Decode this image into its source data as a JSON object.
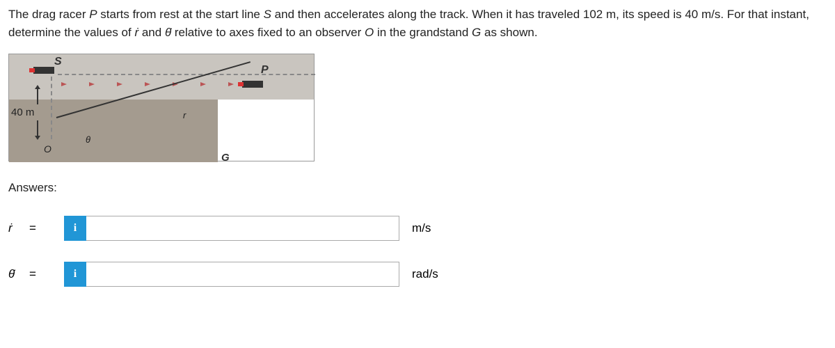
{
  "problem": {
    "text_part1": "The drag racer ",
    "text_part2": " starts from rest at the start line ",
    "text_part3": " and then accelerates along the track. When it has traveled 102 m, its speed is 40 m/s. For that instant, determine the values of ",
    "text_part4": " and ",
    "text_part5": " relative to axes fixed to an observer ",
    "text_part6": " in the grandstand ",
    "text_part7": " as shown.",
    "var_P": "P",
    "var_S": "S",
    "var_rdot": "ṙ",
    "var_thetadot": "θ̇",
    "var_O": "O",
    "var_G": "G"
  },
  "diagram": {
    "start_label": "S",
    "p_label": "P",
    "distance": "40 m",
    "origin": "O",
    "theta": "θ",
    "r_label": "r",
    "g_label": "G"
  },
  "answers": {
    "title": "Answers:",
    "row1": {
      "variable": "ṙ",
      "equals": "=",
      "value": "",
      "unit": "m/s"
    },
    "row2": {
      "variable": "θ̇",
      "equals": "=",
      "value": "",
      "unit": "rad/s"
    },
    "info_icon": "i"
  }
}
